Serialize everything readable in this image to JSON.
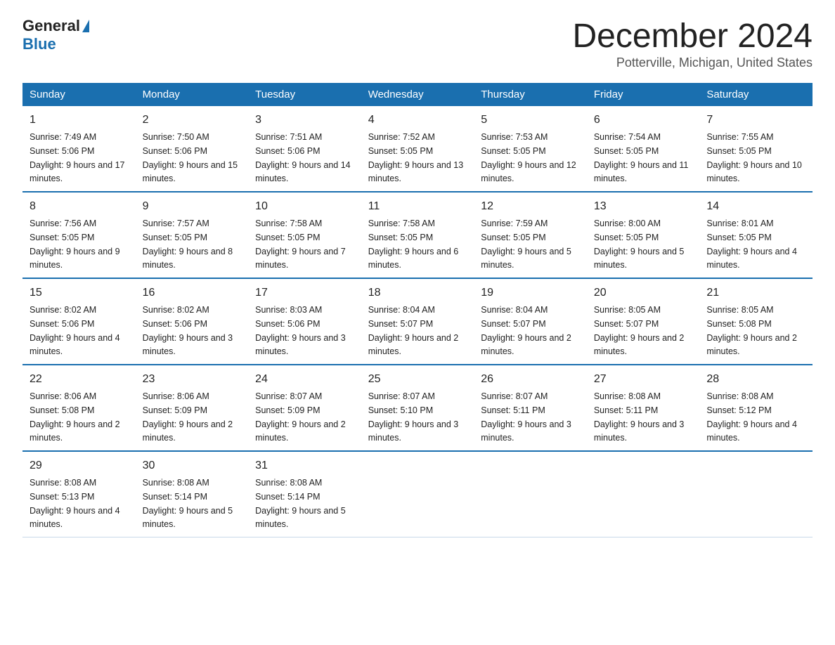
{
  "logo": {
    "general": "General",
    "blue": "Blue"
  },
  "header": {
    "month": "December 2024",
    "location": "Potterville, Michigan, United States"
  },
  "weekdays": [
    "Sunday",
    "Monday",
    "Tuesday",
    "Wednesday",
    "Thursday",
    "Friday",
    "Saturday"
  ],
  "weeks": [
    [
      {
        "day": "1",
        "sunrise": "7:49 AM",
        "sunset": "5:06 PM",
        "daylight": "9 hours and 17 minutes."
      },
      {
        "day": "2",
        "sunrise": "7:50 AM",
        "sunset": "5:06 PM",
        "daylight": "9 hours and 15 minutes."
      },
      {
        "day": "3",
        "sunrise": "7:51 AM",
        "sunset": "5:06 PM",
        "daylight": "9 hours and 14 minutes."
      },
      {
        "day": "4",
        "sunrise": "7:52 AM",
        "sunset": "5:05 PM",
        "daylight": "9 hours and 13 minutes."
      },
      {
        "day": "5",
        "sunrise": "7:53 AM",
        "sunset": "5:05 PM",
        "daylight": "9 hours and 12 minutes."
      },
      {
        "day": "6",
        "sunrise": "7:54 AM",
        "sunset": "5:05 PM",
        "daylight": "9 hours and 11 minutes."
      },
      {
        "day": "7",
        "sunrise": "7:55 AM",
        "sunset": "5:05 PM",
        "daylight": "9 hours and 10 minutes."
      }
    ],
    [
      {
        "day": "8",
        "sunrise": "7:56 AM",
        "sunset": "5:05 PM",
        "daylight": "9 hours and 9 minutes."
      },
      {
        "day": "9",
        "sunrise": "7:57 AM",
        "sunset": "5:05 PM",
        "daylight": "9 hours and 8 minutes."
      },
      {
        "day": "10",
        "sunrise": "7:58 AM",
        "sunset": "5:05 PM",
        "daylight": "9 hours and 7 minutes."
      },
      {
        "day": "11",
        "sunrise": "7:58 AM",
        "sunset": "5:05 PM",
        "daylight": "9 hours and 6 minutes."
      },
      {
        "day": "12",
        "sunrise": "7:59 AM",
        "sunset": "5:05 PM",
        "daylight": "9 hours and 5 minutes."
      },
      {
        "day": "13",
        "sunrise": "8:00 AM",
        "sunset": "5:05 PM",
        "daylight": "9 hours and 5 minutes."
      },
      {
        "day": "14",
        "sunrise": "8:01 AM",
        "sunset": "5:05 PM",
        "daylight": "9 hours and 4 minutes."
      }
    ],
    [
      {
        "day": "15",
        "sunrise": "8:02 AM",
        "sunset": "5:06 PM",
        "daylight": "9 hours and 4 minutes."
      },
      {
        "day": "16",
        "sunrise": "8:02 AM",
        "sunset": "5:06 PM",
        "daylight": "9 hours and 3 minutes."
      },
      {
        "day": "17",
        "sunrise": "8:03 AM",
        "sunset": "5:06 PM",
        "daylight": "9 hours and 3 minutes."
      },
      {
        "day": "18",
        "sunrise": "8:04 AM",
        "sunset": "5:07 PM",
        "daylight": "9 hours and 2 minutes."
      },
      {
        "day": "19",
        "sunrise": "8:04 AM",
        "sunset": "5:07 PM",
        "daylight": "9 hours and 2 minutes."
      },
      {
        "day": "20",
        "sunrise": "8:05 AM",
        "sunset": "5:07 PM",
        "daylight": "9 hours and 2 minutes."
      },
      {
        "day": "21",
        "sunrise": "8:05 AM",
        "sunset": "5:08 PM",
        "daylight": "9 hours and 2 minutes."
      }
    ],
    [
      {
        "day": "22",
        "sunrise": "8:06 AM",
        "sunset": "5:08 PM",
        "daylight": "9 hours and 2 minutes."
      },
      {
        "day": "23",
        "sunrise": "8:06 AM",
        "sunset": "5:09 PM",
        "daylight": "9 hours and 2 minutes."
      },
      {
        "day": "24",
        "sunrise": "8:07 AM",
        "sunset": "5:09 PM",
        "daylight": "9 hours and 2 minutes."
      },
      {
        "day": "25",
        "sunrise": "8:07 AM",
        "sunset": "5:10 PM",
        "daylight": "9 hours and 3 minutes."
      },
      {
        "day": "26",
        "sunrise": "8:07 AM",
        "sunset": "5:11 PM",
        "daylight": "9 hours and 3 minutes."
      },
      {
        "day": "27",
        "sunrise": "8:08 AM",
        "sunset": "5:11 PM",
        "daylight": "9 hours and 3 minutes."
      },
      {
        "day": "28",
        "sunrise": "8:08 AM",
        "sunset": "5:12 PM",
        "daylight": "9 hours and 4 minutes."
      }
    ],
    [
      {
        "day": "29",
        "sunrise": "8:08 AM",
        "sunset": "5:13 PM",
        "daylight": "9 hours and 4 minutes."
      },
      {
        "day": "30",
        "sunrise": "8:08 AM",
        "sunset": "5:14 PM",
        "daylight": "9 hours and 5 minutes."
      },
      {
        "day": "31",
        "sunrise": "8:08 AM",
        "sunset": "5:14 PM",
        "daylight": "9 hours and 5 minutes."
      },
      null,
      null,
      null,
      null
    ]
  ]
}
